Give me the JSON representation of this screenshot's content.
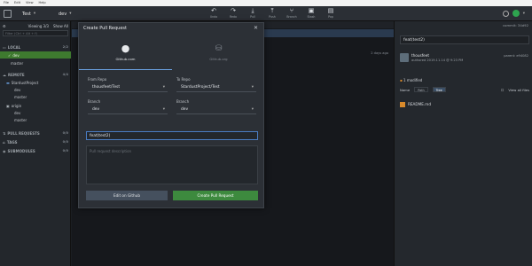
{
  "menu": [
    "File",
    "Edit",
    "View",
    "Help"
  ],
  "toolbar": {
    "repo": "Test",
    "branch": "dev",
    "actions": [
      {
        "label": "Undo",
        "icon": "undo-icon"
      },
      {
        "label": "Redo",
        "icon": "redo-icon"
      },
      {
        "label": "Pull",
        "icon": "pull-icon"
      },
      {
        "label": "Push",
        "icon": "push-icon"
      },
      {
        "label": "Branch",
        "icon": "branch-icon"
      },
      {
        "label": "Stash",
        "icon": "stash-icon"
      },
      {
        "label": "Pop",
        "icon": "pop-icon"
      }
    ]
  },
  "sidebar": {
    "viewing": "Viewing 3/3",
    "show_all": "Show All",
    "filter_placeholder": "Filter (Ctrl + Alt + f)",
    "local": {
      "label": "LOCAL",
      "count": "2/2",
      "items": [
        "dev",
        "master"
      ]
    },
    "remote": {
      "label": "REMOTE",
      "count": "4/4",
      "remotes": [
        {
          "name": "StardustProject",
          "branches": [
            "dev",
            "master"
          ]
        },
        {
          "name": "origin",
          "branches": [
            "dev",
            "master"
          ]
        }
      ]
    },
    "pull_requests": {
      "label": "PULL REQUESTS",
      "count": "0/0"
    },
    "tags": {
      "label": "TAGS",
      "count": "0/0"
    },
    "submodules": {
      "label": "SUBMODULES",
      "count": "0/0"
    }
  },
  "graph": {
    "date": "2 days ago"
  },
  "right_panel": {
    "commit_id": "commit: 34d92",
    "title": "feat(test2)",
    "author": "thousfeet",
    "authored": "authored 2019.11.14 @ 9:23 PM",
    "parent": "parent: e94082",
    "modified": "1 modified",
    "sort_label": "Name",
    "view_path": "Path",
    "view_tree": "Tree",
    "view_all": "View all files",
    "file": "README.md"
  },
  "modal": {
    "title": "Create Pull Request",
    "tabs": [
      {
        "label": "Github.com",
        "icon": "github-icon"
      },
      {
        "label": "Github.org",
        "icon": "database-icon"
      }
    ],
    "from_repo_label": "From Repo",
    "from_repo": "thousfeet/Test",
    "to_repo_label": "To Repo",
    "to_repo": "StardustProject/Test",
    "from_branch_label": "Branch",
    "from_branch": "dev",
    "to_branch_label": "Branch",
    "to_branch": "dev",
    "title_value": "feat(test2)",
    "description_placeholder": "Pull request description",
    "edit_button": "Edit on Github",
    "create_button": "Create Pull Request"
  }
}
